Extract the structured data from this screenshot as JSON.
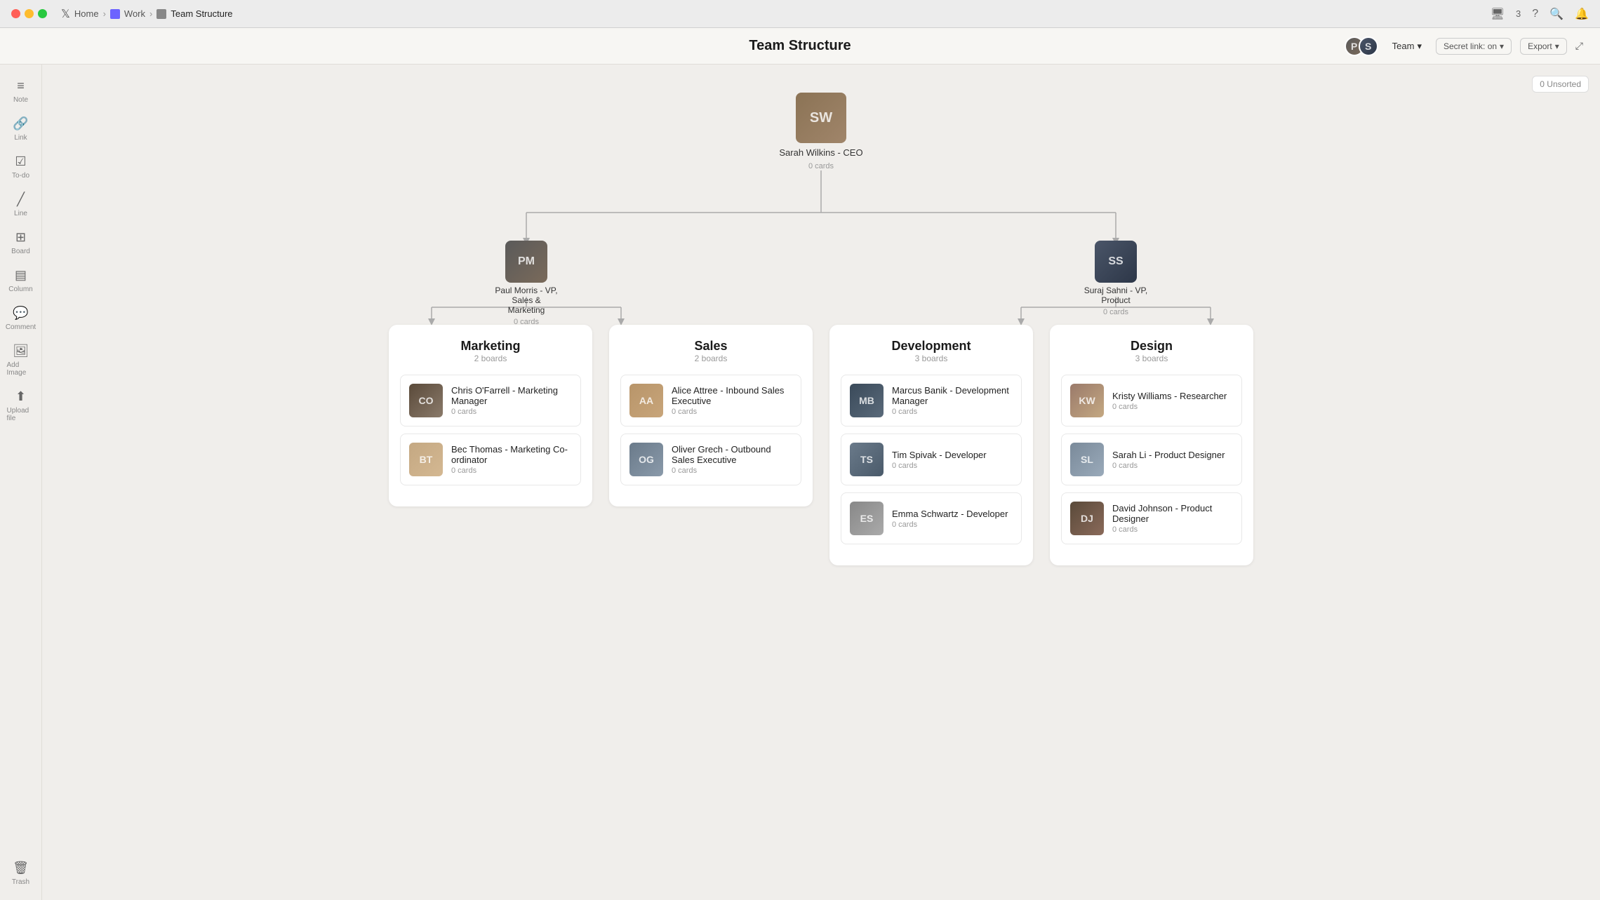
{
  "titlebar": {
    "breadcrumbs": [
      "Home",
      "Work",
      "Team Structure"
    ],
    "work_label": "Work",
    "home_label": "Home",
    "current_label": "Team Structure"
  },
  "topbar": {
    "title": "Team Structure",
    "team_label": "Team",
    "secret_link_label": "Secret link: on",
    "export_label": "Export",
    "unsorted_label": "0 Unsorted"
  },
  "sidebar": {
    "items": [
      {
        "id": "note",
        "label": "Note",
        "icon": "≡"
      },
      {
        "id": "link",
        "label": "Link",
        "icon": "🔗"
      },
      {
        "id": "todo",
        "label": "To-do",
        "icon": "☑"
      },
      {
        "id": "line",
        "label": "Line",
        "icon": "╱"
      },
      {
        "id": "board",
        "label": "Board",
        "icon": "⊞"
      },
      {
        "id": "column",
        "label": "Column",
        "icon": "▤"
      },
      {
        "id": "comment",
        "label": "Comment",
        "icon": "💬"
      },
      {
        "id": "addimage",
        "label": "Add Image",
        "icon": "🖼"
      },
      {
        "id": "uploadfile",
        "label": "Upload file",
        "icon": "⬆"
      }
    ],
    "bottom_items": [
      {
        "id": "trash",
        "label": "Trash",
        "icon": "🗑"
      }
    ]
  },
  "ceo": {
    "name": "Sarah Wilkins - CEO",
    "cards": "0 cards",
    "initials": "SW",
    "avatar_color": "av-ceo"
  },
  "vp_left": {
    "name": "Paul Morris - VP, Sales & Marketing",
    "name_line1": "Paul Morris - VP, Sales &",
    "name_line2": "Marketing",
    "cards": "0 cards",
    "initials": "PM",
    "avatar_color": "av-paul"
  },
  "vp_right": {
    "name": "Suraj Sahni - VP, Product",
    "cards": "0 cards",
    "initials": "SS",
    "avatar_color": "av-suraj"
  },
  "departments": [
    {
      "id": "marketing",
      "title": "Marketing",
      "boards": "2 boards",
      "members": [
        {
          "name": "Chris O'Farrell - Marketing Manager",
          "cards": "0 cards",
          "initials": "CO",
          "color": "av-chris"
        },
        {
          "name": "Bec Thomas - Marketing Co-ordinator",
          "cards": "0 cards",
          "initials": "BT",
          "color": "av-bec"
        }
      ]
    },
    {
      "id": "sales",
      "title": "Sales",
      "boards": "2 boards",
      "members": [
        {
          "name": "Alice Attree - Inbound Sales Executive",
          "cards": "0 cards",
          "initials": "AA",
          "color": "av-alice"
        },
        {
          "name": "Oliver Grech - Outbound Sales Executive",
          "cards": "0 cards",
          "initials": "OG",
          "color": "av-oliver"
        }
      ]
    },
    {
      "id": "development",
      "title": "Development",
      "boards": "3 boards",
      "members": [
        {
          "name": "Marcus Banik - Development Manager",
          "cards": "0 cards",
          "initials": "MB",
          "color": "av-marcus"
        },
        {
          "name": "Tim Spivak - Developer",
          "cards": "0 cards",
          "initials": "TS",
          "color": "av-tim"
        },
        {
          "name": "Emma Schwartz - Developer",
          "cards": "0 cards",
          "initials": "ES",
          "color": "av-emma"
        }
      ]
    },
    {
      "id": "design",
      "title": "Design",
      "boards": "3 boards",
      "members": [
        {
          "name": "Kristy Williams - Researcher",
          "cards": "0 cards",
          "initials": "KW",
          "color": "av-kristy"
        },
        {
          "name": "Sarah Li - Product Designer",
          "cards": "0 cards",
          "initials": "SL",
          "color": "av-sarah-li"
        },
        {
          "name": "David Johnson - Product Designer",
          "cards": "0 cards",
          "initials": "DJ",
          "color": "av-david"
        }
      ]
    }
  ]
}
